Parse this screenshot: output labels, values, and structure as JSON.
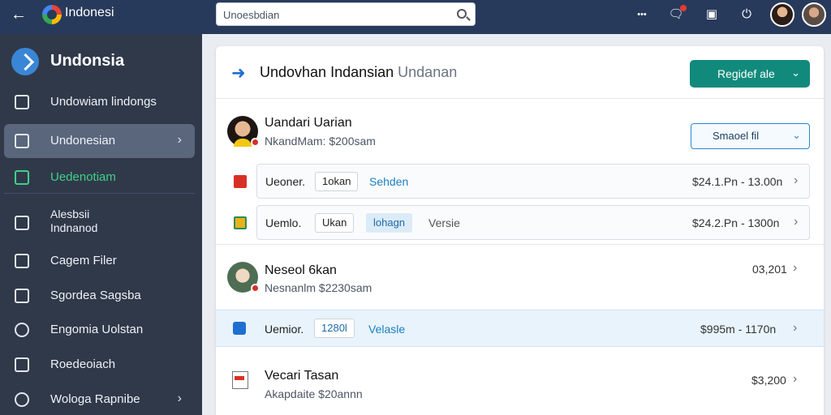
{
  "topbar": {
    "app_name": "Indonesi",
    "search_placeholder": "Unoesbdian",
    "more_label": "•••"
  },
  "sidebar": {
    "title": "Undonsia",
    "items": [
      {
        "label": "Undowiam lindongs",
        "icon": "home-icon"
      },
      {
        "label": "Undonesian",
        "icon": "folder-icon",
        "chevron": "›"
      },
      {
        "label": "Uedenotiam",
        "icon": "calendar-icon"
      },
      {
        "label_line1": "Alesbsii",
        "label_line2": "Indnanod",
        "icon": "mail-icon"
      },
      {
        "label": "Cagem Filer",
        "icon": "image-icon"
      },
      {
        "label": "Sgordea Sagsba",
        "icon": "grid-icon"
      },
      {
        "label": "Engomia Uolstan",
        "icon": "wrench-icon"
      },
      {
        "label": "Roedeoiach",
        "icon": "document-icon"
      },
      {
        "label": "Wologa Rapnibe",
        "icon": "gear-icon",
        "chevron": "›"
      }
    ]
  },
  "panel": {
    "title": "Undovhan Indansian",
    "title_muted": "Undanan",
    "primary_button": "Regidef ale",
    "user1": {
      "name": "Uandari Uarian",
      "sub": "NkandMam: $200sam"
    },
    "outline_button": "Smaoel fil",
    "card1": {
      "label": "Ueoner.",
      "chip": "1okan",
      "link": "Sehden",
      "amount": "$24.1.Pn  -  13.00n"
    },
    "card2": {
      "label": "Uemlo.",
      "chip": "Ukan",
      "chip2": "lohagn",
      "plain": "Versie",
      "amount": "$24.2.Pn  -  1300n"
    },
    "user2": {
      "name": "Neseol 6kan",
      "sub": "Nesnanlm $2230sam",
      "amount": "03,201"
    },
    "highlight_row": {
      "label": "Uemior.",
      "chip": "1280l",
      "link": "Velasle",
      "amount": "$995m  -  1170n"
    },
    "user3": {
      "name": "Vecari Tasan",
      "sub": "Akapdaite $20annn",
      "amount": "$3,200"
    },
    "chevron": "›"
  }
}
